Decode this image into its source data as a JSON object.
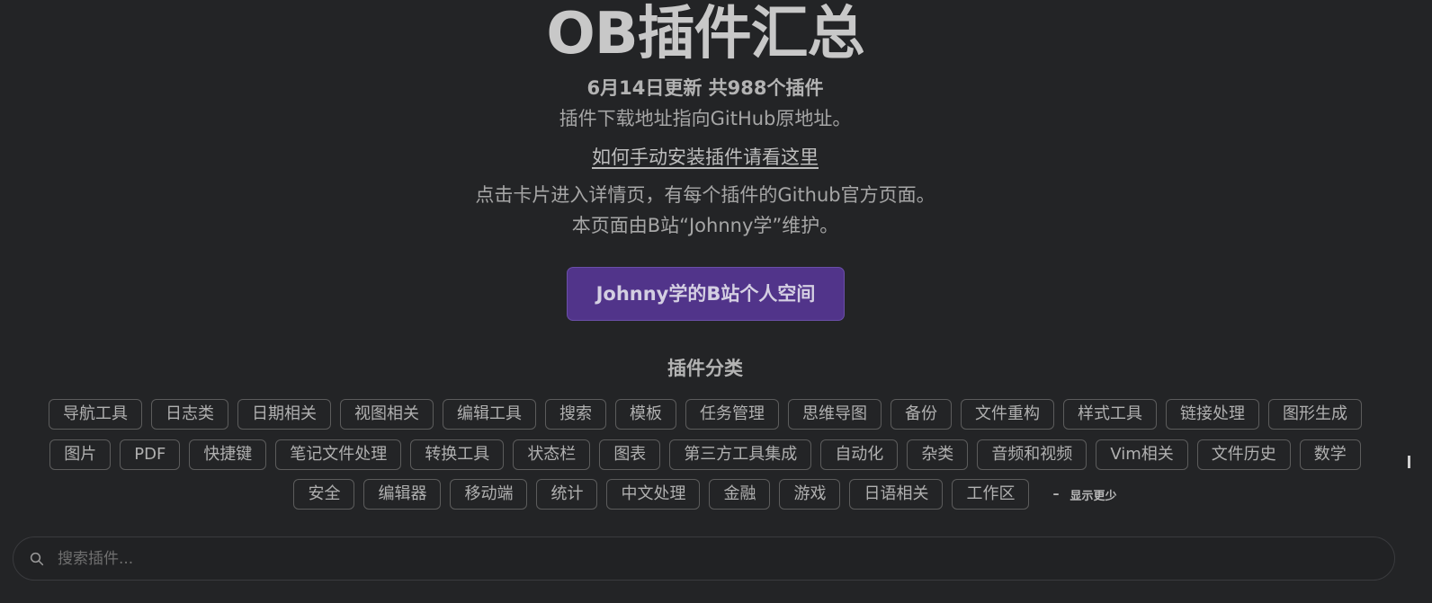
{
  "header": {
    "title": "OB插件汇总",
    "update_info": "6月14日更新 共988个插件",
    "download_note": "插件下载地址指向GitHub原地址。",
    "manual_install_link": "如何手动安装插件请看这里",
    "card_note": "点击卡片进入详情页，有每个插件的Github官方页面。",
    "maintainer_note": "本页面由B站“Johnny学”维护。"
  },
  "space_button": {
    "label": "Johnny学的B站个人空间",
    "color": "#51348a"
  },
  "categories": {
    "heading": "插件分类",
    "row1": [
      "导航工具",
      "日志类",
      "日期相关",
      "视图相关",
      "编辑工具",
      "搜索",
      "模板",
      "任务管理",
      "思维导图",
      "备份",
      "文件重构",
      "样式工具",
      "链接处理",
      "图形生成"
    ],
    "row2": [
      "图片",
      "PDF",
      "快捷键",
      "笔记文件处理",
      "转换工具",
      "状态栏",
      "图表",
      "第三方工具集成",
      "自动化",
      "杂类",
      "音频和视频",
      "Vim相关",
      "文件历史",
      "数学"
    ],
    "row3": [
      "安全",
      "编辑器",
      "移动端",
      "统计",
      "中文处理",
      "金融",
      "游戏",
      "日语相关",
      "工作区"
    ],
    "show_less_label": "显示更少",
    "show_less_icon": "minus-icon"
  },
  "search": {
    "placeholder": "搜索插件...",
    "value": "",
    "icon": "search-icon"
  }
}
